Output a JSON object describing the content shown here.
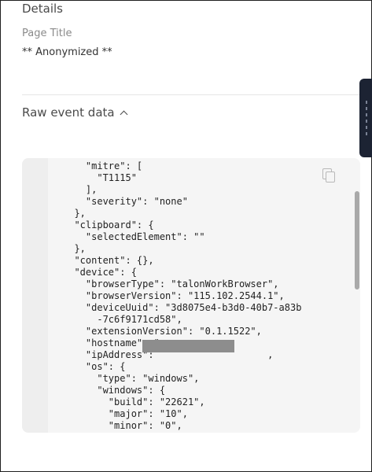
{
  "details": {
    "title": "Details",
    "page_title_label": "Page Title",
    "page_title_value": "** Anonymized **"
  },
  "raw_event": {
    "header": "Raw event data",
    "toggle_icon": "chevron-up-icon",
    "copy_icon": "copy-icon",
    "code_lines": [
      "    \"mitre\": [",
      "      \"T1115\"",
      "    ],",
      "    \"severity\": \"none\"",
      "  },",
      "  \"clipboard\": {",
      "    \"selectedElement\": \"\"",
      "  },",
      "  \"content\": {},",
      "  \"device\": {",
      "    \"browserType\": \"talonWorkBrowser\",",
      "    \"browserVersion\": \"115.102.2544.1\",",
      "    \"deviceUuid\": \"3d8075e4-b3d0-40b7-a83b",
      "      -7c6f9171cd58\",",
      "    \"extensionVersion\": \"0.1.1522\",",
      "    \"hostname\": \"",
      "    \"ipAddress\":                    ,",
      "    \"os\": {",
      "      \"type\": \"windows\",",
      "      \"windows\": {",
      "        \"build\": \"22621\",",
      "        \"major\": \"10\",",
      "        \"minor\": \"0\","
    ]
  },
  "side_panel_icon": "drag-handle-icon"
}
